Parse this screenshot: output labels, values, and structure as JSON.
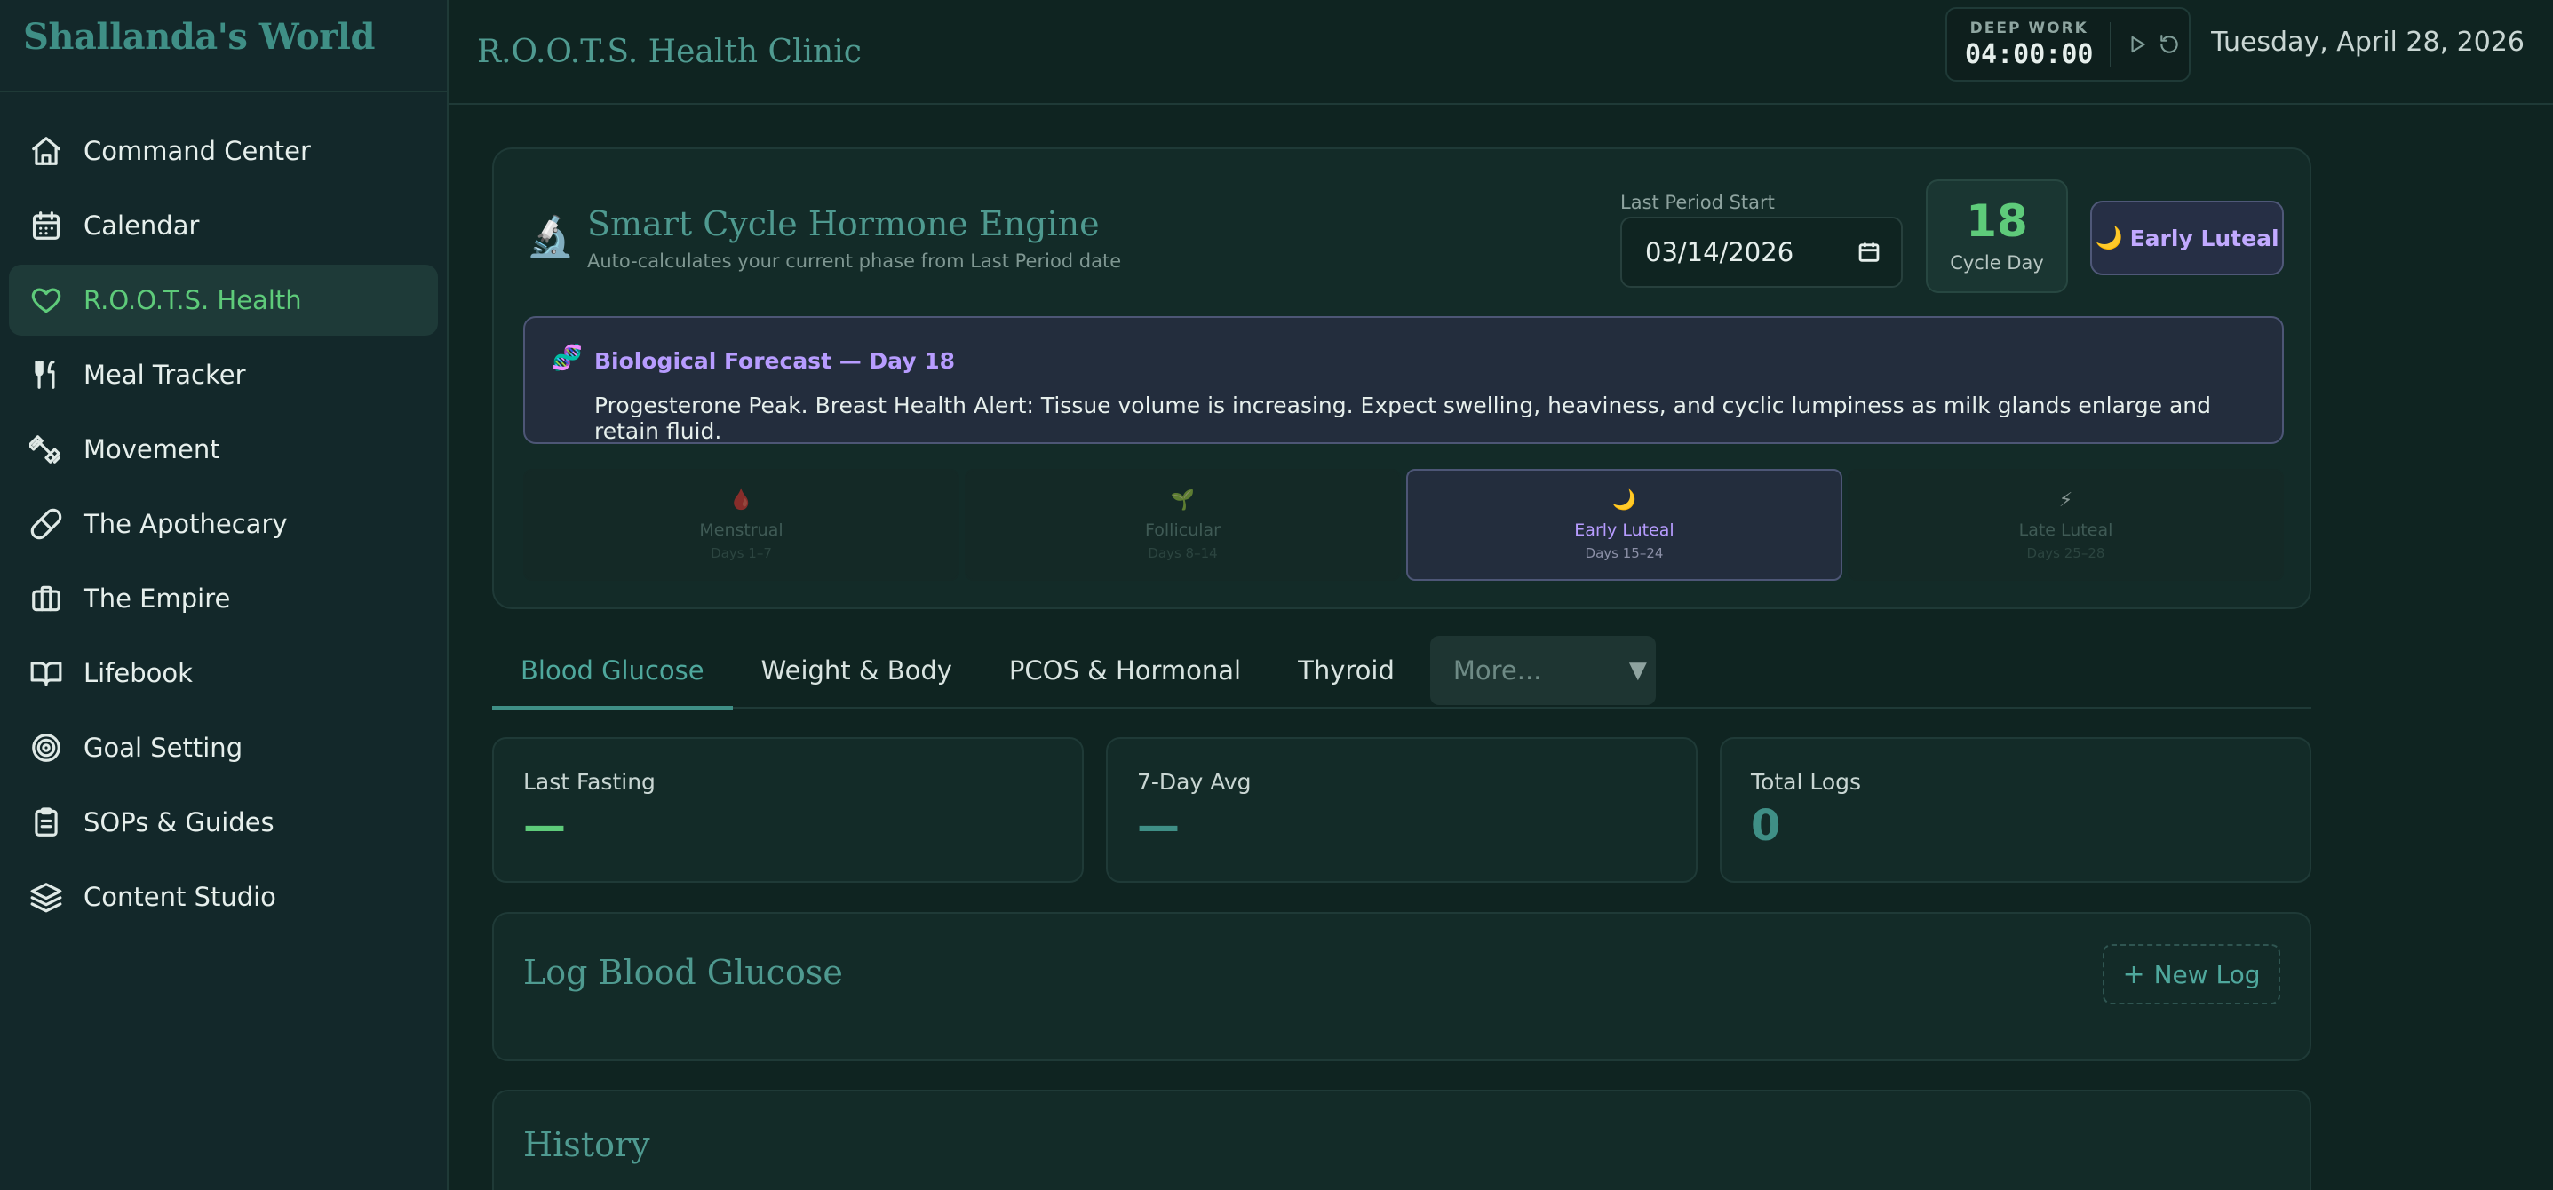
{
  "brand": "Shallanda's World",
  "sidebar": {
    "items": [
      {
        "label": "Command Center",
        "icon": "home-icon"
      },
      {
        "label": "Calendar",
        "icon": "calendar-icon"
      },
      {
        "label": "R.O.O.T.S. Health",
        "icon": "heart-icon",
        "active": true
      },
      {
        "label": "Meal Tracker",
        "icon": "utensils-icon"
      },
      {
        "label": "Movement",
        "icon": "dumbbell-icon"
      },
      {
        "label": "The Apothecary",
        "icon": "pill-icon"
      },
      {
        "label": "The Empire",
        "icon": "briefcase-icon"
      },
      {
        "label": "Lifebook",
        "icon": "book-icon"
      },
      {
        "label": "Goal Setting",
        "icon": "target-icon"
      },
      {
        "label": "SOPs & Guides",
        "icon": "clipboard-icon"
      },
      {
        "label": "Content Studio",
        "icon": "layers-icon"
      }
    ]
  },
  "header": {
    "title": "R.O.O.T.S. Health Clinic",
    "deep_work_label": "DEEP WORK",
    "deep_work_time": "04:00:00",
    "date": "Tuesday, April 28, 2026"
  },
  "cycle": {
    "title": "Smart Cycle Hormone Engine",
    "subtitle": "Auto-calculates your current phase from Last Period date",
    "last_period_label": "Last Period Start",
    "last_period_value": "03/14/2026",
    "cycle_day": "18",
    "cycle_day_label": "Cycle Day",
    "phase_badge": "Early Luteal",
    "forecast_title": "Biological Forecast — Day 18",
    "forecast_text": "Progesterone Peak. Breast Health Alert: Tissue volume is increasing. Expect swelling, heaviness, and cyclic lumpiness as milk glands enlarge and retain fluid.",
    "phases": [
      {
        "name": "Menstrual",
        "days": "Days 1–7",
        "icon": "drop-icon"
      },
      {
        "name": "Follicular",
        "days": "Days 8–14",
        "icon": "sprout-icon"
      },
      {
        "name": "Early Luteal",
        "days": "Days 15–24",
        "icon": "moon-icon",
        "active": true
      },
      {
        "name": "Late Luteal",
        "days": "Days 25–28",
        "icon": "lightning-icon"
      }
    ]
  },
  "tabs": {
    "items": [
      "Blood Glucose",
      "Weight & Body",
      "PCOS & Hormonal",
      "Thyroid"
    ],
    "more_label": "More..."
  },
  "stats": [
    {
      "label": "Last Fasting",
      "value": "—",
      "color": "#5ecb7a"
    },
    {
      "label": "7-Day Avg",
      "value": "—",
      "color": "#3f8f86"
    },
    {
      "label": "Total Logs",
      "value": "0",
      "color": "#3f8f86"
    }
  ],
  "log": {
    "title": "Log Blood Glucose",
    "new_log_label": "New Log"
  },
  "history": {
    "title": "History"
  },
  "colors": {
    "accent_green": "#5ecb7a",
    "accent_teal": "#3f8f86",
    "accent_purple": "#b79cff",
    "background": "#0f2421"
  }
}
